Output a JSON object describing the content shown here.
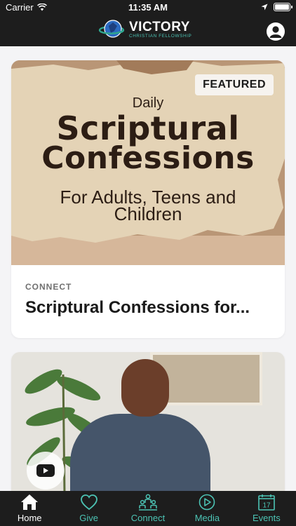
{
  "status_bar": {
    "carrier": "Carrier",
    "time": "11:35 AM"
  },
  "header": {
    "logo_title": "VICTORY",
    "logo_subtitle": "CHRISTIAN FELLOWSHIP"
  },
  "featured_card": {
    "badge": "FEATURED",
    "image_text": {
      "daily": "Daily",
      "title_line1": "Scriptural",
      "title_line2": "Confessions",
      "subtitle_line1": "For Adults, Teens and",
      "subtitle_line2": "Children"
    },
    "category": "CONNECT",
    "title": "Scriptural Confessions for..."
  },
  "tabs": [
    {
      "label": "Home",
      "icon": "home-icon",
      "active": true
    },
    {
      "label": "Give",
      "icon": "heart-icon",
      "active": false
    },
    {
      "label": "Connect",
      "icon": "people-icon",
      "active": false
    },
    {
      "label": "Media",
      "icon": "play-circle-icon",
      "active": false
    },
    {
      "label": "Events",
      "icon": "calendar-icon",
      "active": false,
      "calendar_day": "17"
    }
  ],
  "colors": {
    "bar_background": "#1d1d1d",
    "accent": "#4cc3b4",
    "page_background": "#f4f4f6"
  }
}
